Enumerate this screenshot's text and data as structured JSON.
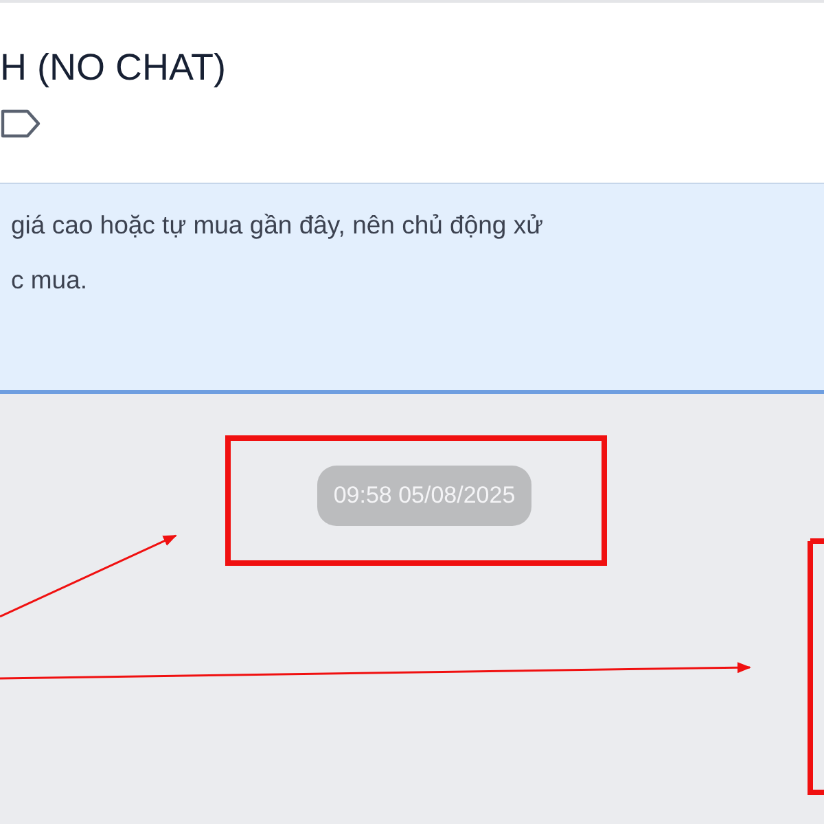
{
  "header": {
    "title": "H (NO CHAT)"
  },
  "notice": {
    "lines": [
      "giá cao hoặc tự mua gần đây, nên chủ động xử",
      "c mua."
    ]
  },
  "chat": {
    "timestamp": "09:58 05/08/2025"
  }
}
